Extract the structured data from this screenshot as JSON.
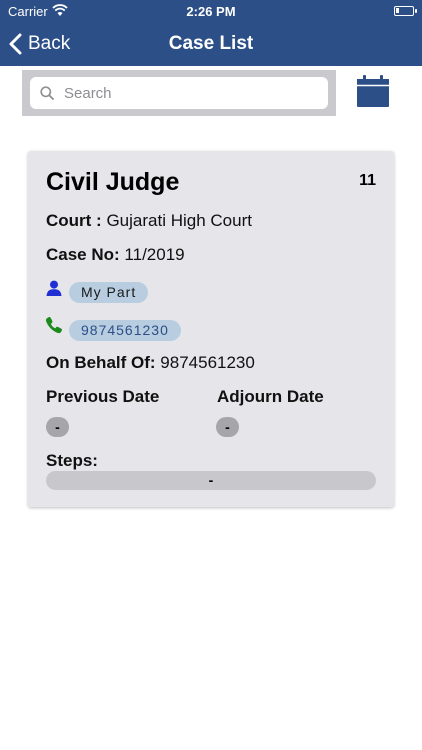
{
  "status_bar": {
    "carrier": "Carrier",
    "time": "2:26 PM"
  },
  "nav": {
    "back_label": "Back",
    "title": "Case List"
  },
  "search": {
    "placeholder": "Search",
    "value": ""
  },
  "colors": {
    "nav_bar": "#2c4f87",
    "card_background": "#e5e5ea",
    "chip_background": "#b8cde0",
    "party_icon": "#1f2fd4",
    "phone_icon": "#1a8a1a"
  },
  "icons": {
    "back": "chevron-left-icon",
    "search": "magnifier-icon",
    "calendar": "calendar-icon",
    "party": "person-icon",
    "phone": "phone-icon"
  },
  "cases": [
    {
      "court_name": "Civil Judge",
      "count": "11",
      "court_label": "Court :",
      "court_value": "Gujarati High Court",
      "case_no_label": "Case No:",
      "case_no_value": "11/2019",
      "party": "My Part",
      "phone": "9874561230",
      "behalf_label": "On Behalf Of:",
      "behalf_value": "9874561230",
      "previous_date_label": "Previous Date",
      "previous_date_value": "-",
      "adjourn_date_label": "Adjourn Date",
      "adjourn_date_value": "-",
      "steps_label": "Steps:",
      "steps_value": "-"
    }
  ]
}
